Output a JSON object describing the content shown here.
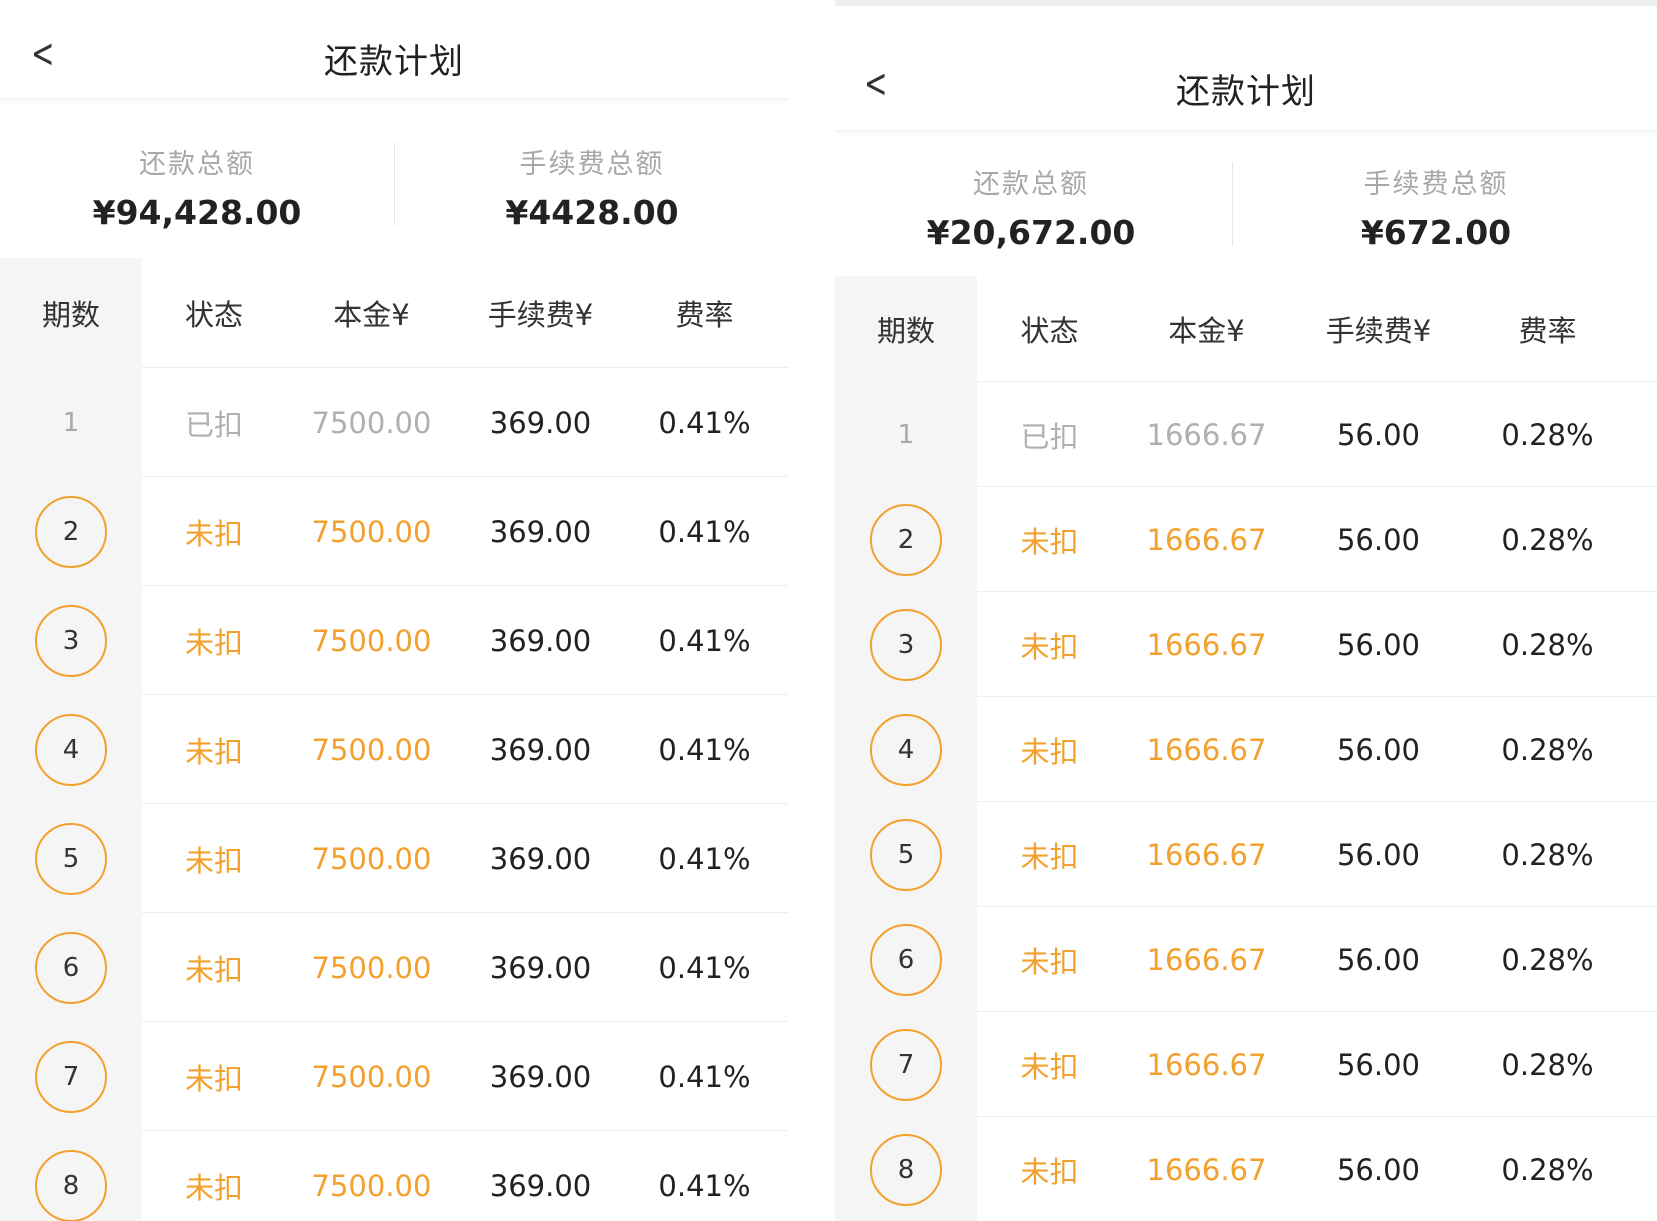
{
  "screens": [
    {
      "title": "还款计划",
      "back_icon": "chevron-left-icon",
      "summary": {
        "total_label": "还款总额",
        "total_value": "¥94,428.00",
        "fee_label": "手续费总额",
        "fee_value": "¥4428.00"
      },
      "columns": [
        "期数",
        "状态",
        "本金¥",
        "手续费¥",
        "费率"
      ],
      "rows": [
        {
          "period": "1",
          "status": "已扣",
          "principal": "7500.00",
          "fee": "369.00",
          "rate": "0.41%",
          "paid": true
        },
        {
          "period": "2",
          "status": "未扣",
          "principal": "7500.00",
          "fee": "369.00",
          "rate": "0.41%",
          "paid": false
        },
        {
          "period": "3",
          "status": "未扣",
          "principal": "7500.00",
          "fee": "369.00",
          "rate": "0.41%",
          "paid": false
        },
        {
          "period": "4",
          "status": "未扣",
          "principal": "7500.00",
          "fee": "369.00",
          "rate": "0.41%",
          "paid": false
        },
        {
          "period": "5",
          "status": "未扣",
          "principal": "7500.00",
          "fee": "369.00",
          "rate": "0.41%",
          "paid": false
        },
        {
          "period": "6",
          "status": "未扣",
          "principal": "7500.00",
          "fee": "369.00",
          "rate": "0.41%",
          "paid": false
        },
        {
          "period": "7",
          "status": "未扣",
          "principal": "7500.00",
          "fee": "369.00",
          "rate": "0.41%",
          "paid": false
        },
        {
          "period": "8",
          "status": "未扣",
          "principal": "7500.00",
          "fee": "369.00",
          "rate": "0.41%",
          "paid": false
        }
      ]
    },
    {
      "title": "还款计划",
      "back_icon": "chevron-left-icon",
      "summary": {
        "total_label": "还款总额",
        "total_value": "¥20,672.00",
        "fee_label": "手续费总额",
        "fee_value": "¥672.00"
      },
      "columns": [
        "期数",
        "状态",
        "本金¥",
        "手续费¥",
        "费率"
      ],
      "rows": [
        {
          "period": "1",
          "status": "已扣",
          "principal": "1666.67",
          "fee": "56.00",
          "rate": "0.28%",
          "paid": true
        },
        {
          "period": "2",
          "status": "未扣",
          "principal": "1666.67",
          "fee": "56.00",
          "rate": "0.28%",
          "paid": false
        },
        {
          "period": "3",
          "status": "未扣",
          "principal": "1666.67",
          "fee": "56.00",
          "rate": "0.28%",
          "paid": false
        },
        {
          "period": "4",
          "status": "未扣",
          "principal": "1666.67",
          "fee": "56.00",
          "rate": "0.28%",
          "paid": false
        },
        {
          "period": "5",
          "status": "未扣",
          "principal": "1666.67",
          "fee": "56.00",
          "rate": "0.28%",
          "paid": false
        },
        {
          "period": "6",
          "status": "未扣",
          "principal": "1666.67",
          "fee": "56.00",
          "rate": "0.28%",
          "paid": false
        },
        {
          "period": "7",
          "status": "未扣",
          "principal": "1666.67",
          "fee": "56.00",
          "rate": "0.28%",
          "paid": false
        },
        {
          "period": "8",
          "status": "未扣",
          "principal": "1666.67",
          "fee": "56.00",
          "rate": "0.28%",
          "paid": false
        }
      ]
    }
  ],
  "colors": {
    "accent": "#f3a12e",
    "muted": "#b0b0b0",
    "text": "#222222",
    "period_bg": "#f5f5f5"
  }
}
